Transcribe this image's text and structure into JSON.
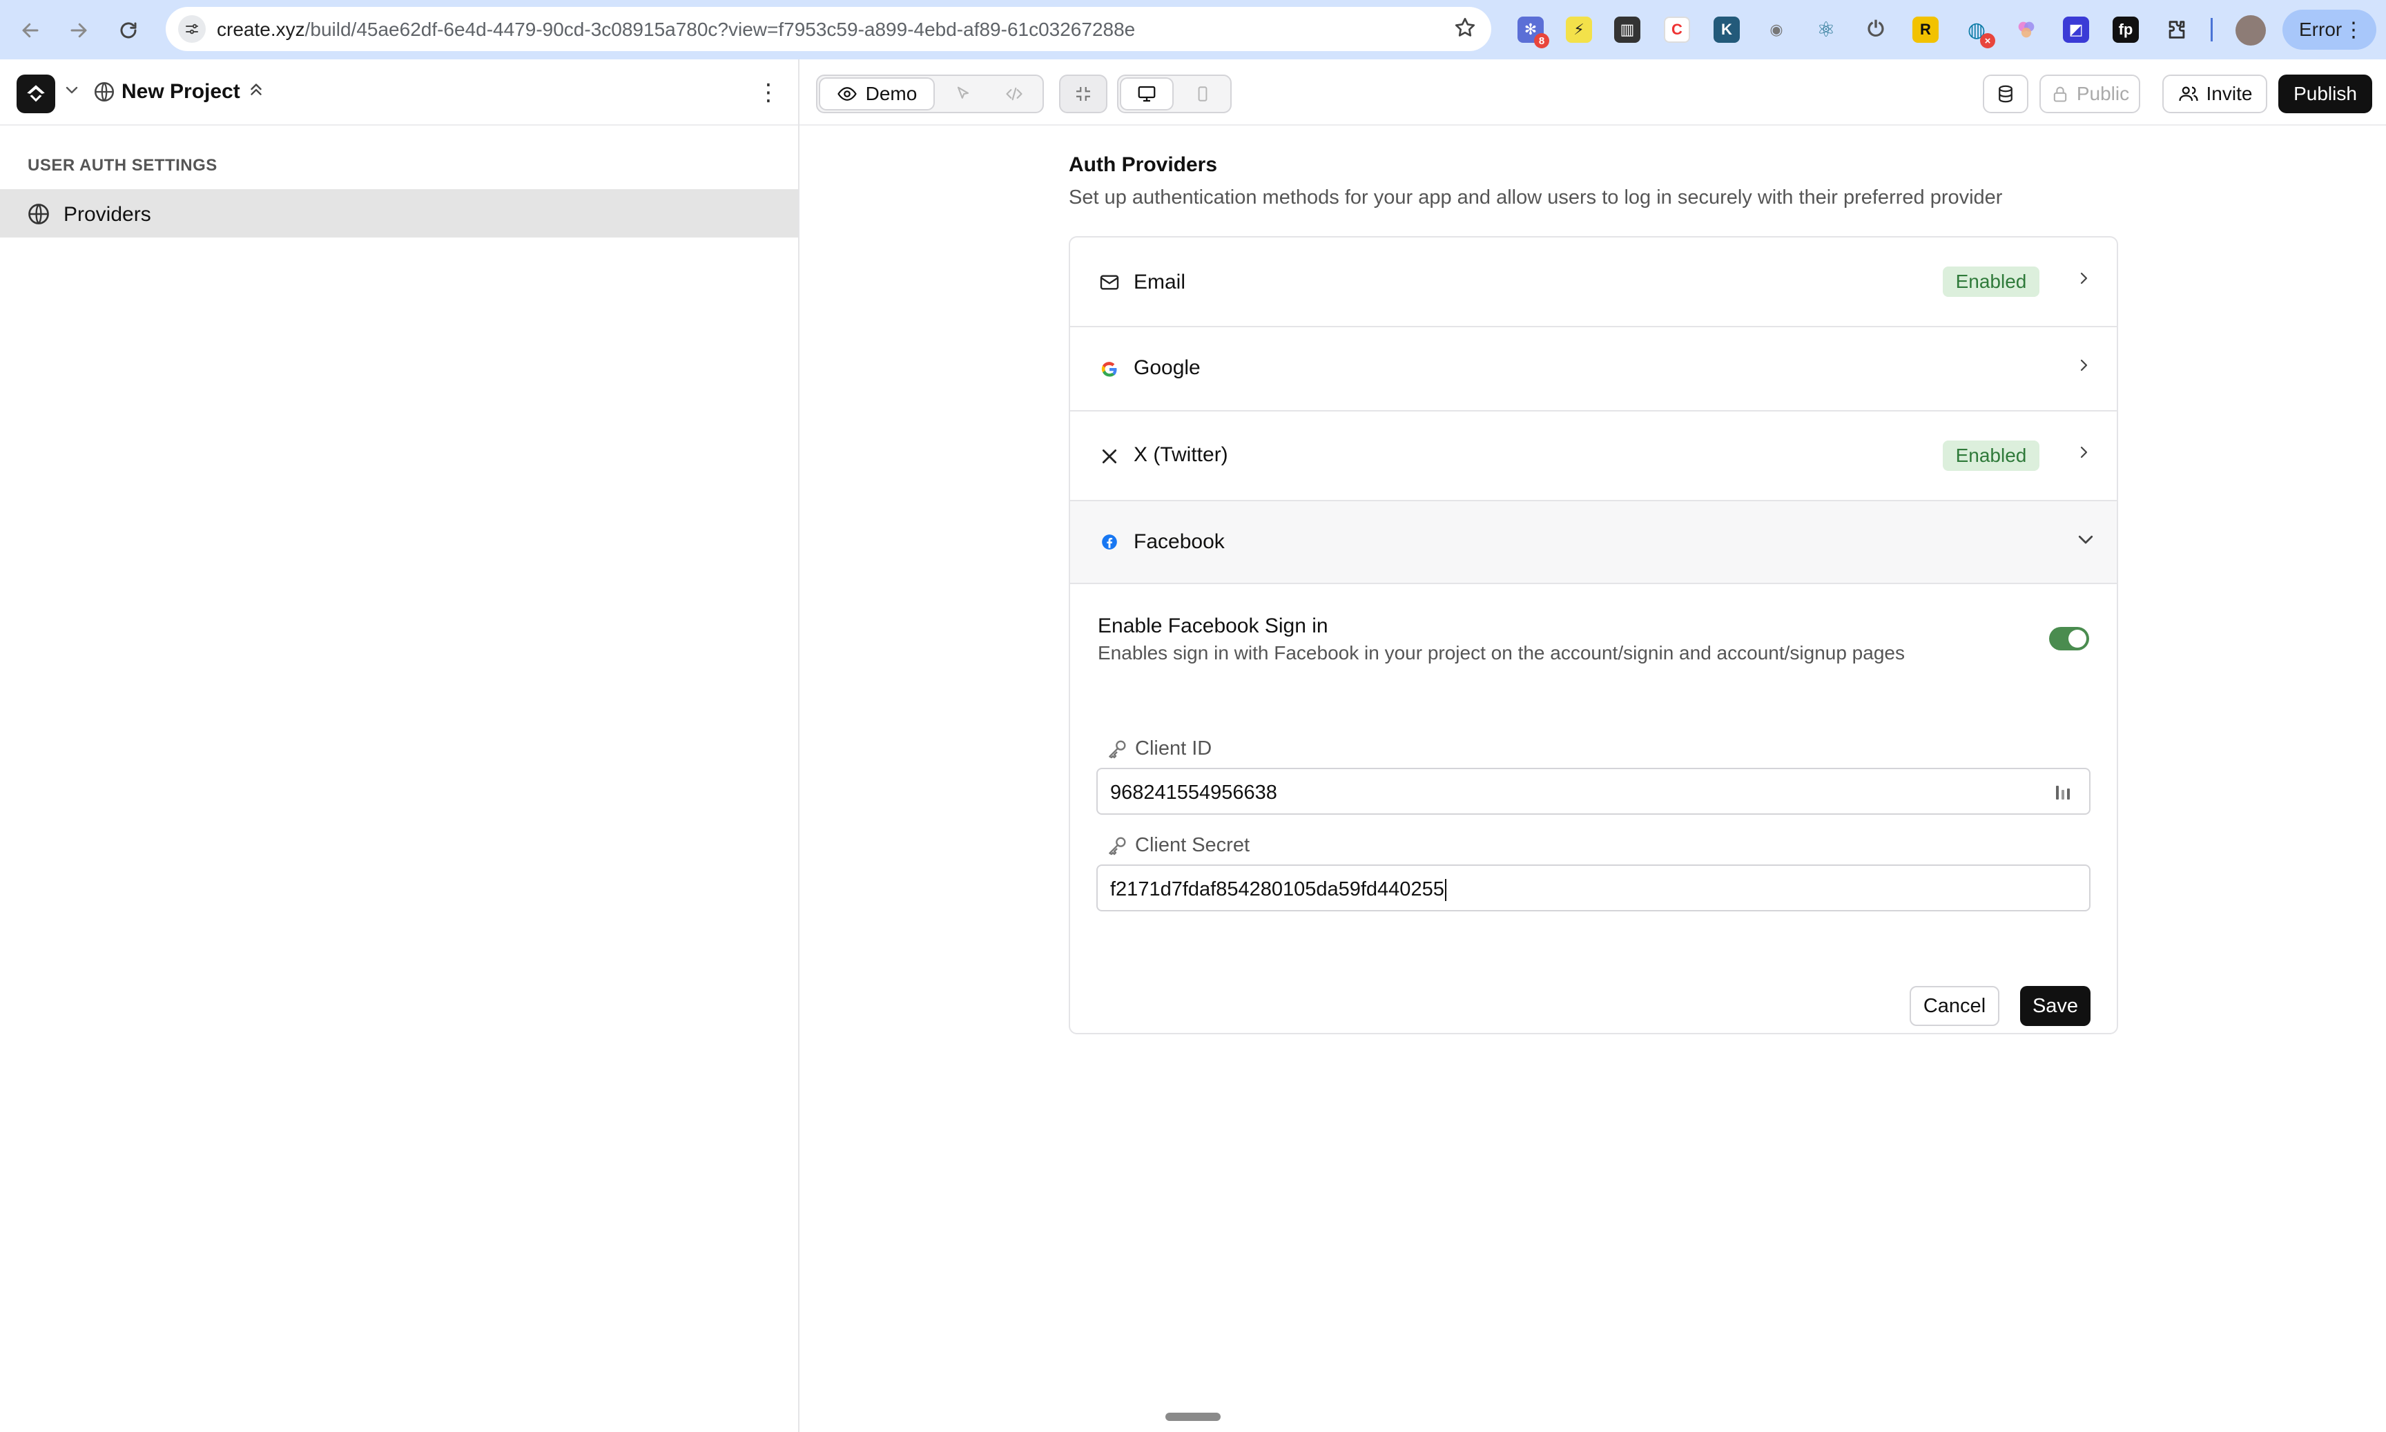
{
  "browser": {
    "url_host": "create.xyz",
    "url_path": "/build/45ae62df-6e4d-4479-90cd-3c08915a780c?view=f7953c59-a899-4ebd-af89-61c03267288e",
    "extension_badge": "8",
    "profile_button": "Error"
  },
  "project": {
    "name": "New Project"
  },
  "sidebar": {
    "section_title": "USER AUTH SETTINGS",
    "items": [
      {
        "label": "Providers",
        "icon": "globe-icon",
        "selected": true
      }
    ]
  },
  "toolbar": {
    "demo_label": "Demo",
    "public_label": "Public",
    "invite_label": "Invite",
    "publish_label": "Publish"
  },
  "auth": {
    "title": "Auth Providers",
    "subtitle": "Set up authentication methods for your app and allow users to log in securely with their preferred provider",
    "providers": [
      {
        "name": "Email",
        "icon": "mail-icon",
        "status": "Enabled"
      },
      {
        "name": "Google",
        "icon": "google-icon",
        "status": ""
      },
      {
        "name": "X (Twitter)",
        "icon": "x-icon",
        "status": "Enabled"
      },
      {
        "name": "Facebook",
        "icon": "facebook-icon",
        "status": "",
        "expanded": true
      }
    ],
    "facebook": {
      "enable_title": "Enable Facebook Sign in",
      "enable_desc": "Enables sign in with Facebook in your project on the account/signin and account/signup pages",
      "enabled": true,
      "client_id_label": "Client ID",
      "client_id_value": "968241554956638",
      "client_secret_label": "Client Secret",
      "client_secret_value": "f2171d7fdaf854280105da59fd440255",
      "cancel_label": "Cancel",
      "save_label": "Save"
    }
  },
  "colors": {
    "enabled_badge_bg": "#dcefdc",
    "enabled_badge_text": "#2f7a3a",
    "toggle_on": "#4a8c4f",
    "primary_button": "#111111"
  }
}
